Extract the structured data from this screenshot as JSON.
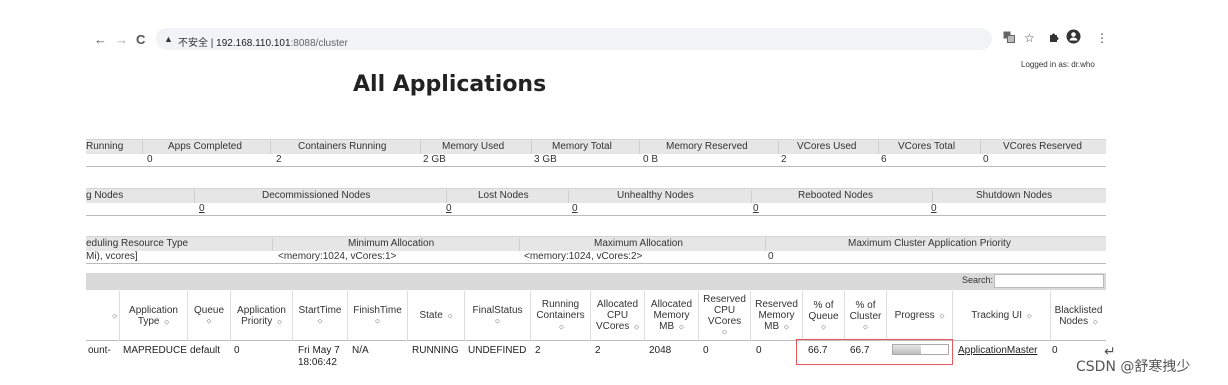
{
  "browser": {
    "back": "←",
    "forward": "→",
    "reload": "C",
    "security_icon": "▲",
    "security_text": "不安全 |",
    "host": "192.168.110.101",
    "path": ":8088/cluster",
    "icons": [
      "translate-icon",
      "star-icon",
      "puzzle-icon",
      "profile-icon",
      "menu-icon"
    ]
  },
  "logged_in": "Logged in as: dr.who",
  "page_title": "All Applications",
  "cluster_metrics": {
    "headers": [
      "Running",
      "Apps Completed",
      "Containers Running",
      "Memory Used",
      "Memory Total",
      "Memory Reserved",
      "VCores Used",
      "VCores Total",
      "VCores Reserved"
    ],
    "values": [
      "0",
      "2",
      "2 GB",
      "3 GB",
      "0 B",
      "2",
      "6",
      "0",
      ""
    ]
  },
  "node_metrics": {
    "headers": [
      "g Nodes",
      "Decommissioned Nodes",
      "Lost Nodes",
      "Unhealthy Nodes",
      "Rebooted Nodes",
      "Shutdown Nodes"
    ],
    "values": [
      "0",
      "0",
      "0",
      "0",
      "0"
    ]
  },
  "scheduler_metrics": {
    "headers": [
      "eduling Resource Type",
      "Minimum Allocation",
      "Maximum Allocation",
      "Maximum Cluster Application Priority"
    ],
    "values": [
      "Mi), vcores]",
      "<memory:1024, vCores:1>",
      "<memory:1024, vCores:2>",
      "0"
    ]
  },
  "search": {
    "label": "Search:",
    "value": ""
  },
  "apps_table": {
    "headers": [
      "",
      "Application Type",
      "Queue",
      "Application Priority",
      "StartTime",
      "FinishTime",
      "State",
      "FinalStatus",
      "Running Containers",
      "Allocated CPU VCores",
      "Allocated Memory MB",
      "Reserved CPU VCores",
      "Reserved Memory MB",
      "% of Queue",
      "% of Cluster",
      "Progress",
      "Tracking UI",
      "Blacklisted Nodes"
    ],
    "sort_arrow": "⬦",
    "row": {
      "name": "ount-",
      "type": "MAPREDUCE",
      "queue": "default",
      "priority": "0",
      "start": "Fri May 7",
      "start2": "18:06:42",
      "finish": "N/A",
      "state": "RUNNING",
      "final_status": "UNDEFINED",
      "running_containers": "2",
      "alloc_vcores": "2",
      "alloc_memory": "2048",
      "reserved_vcores": "0",
      "reserved_memory": "0",
      "pct_queue": "66.7",
      "pct_cluster": "66.7",
      "progress": 0.5,
      "tracking_ui": "ApplicationMaster",
      "blacklisted": "0"
    }
  },
  "watermark": "CSDN @舒寒拽少",
  "return_glyph": "↵"
}
